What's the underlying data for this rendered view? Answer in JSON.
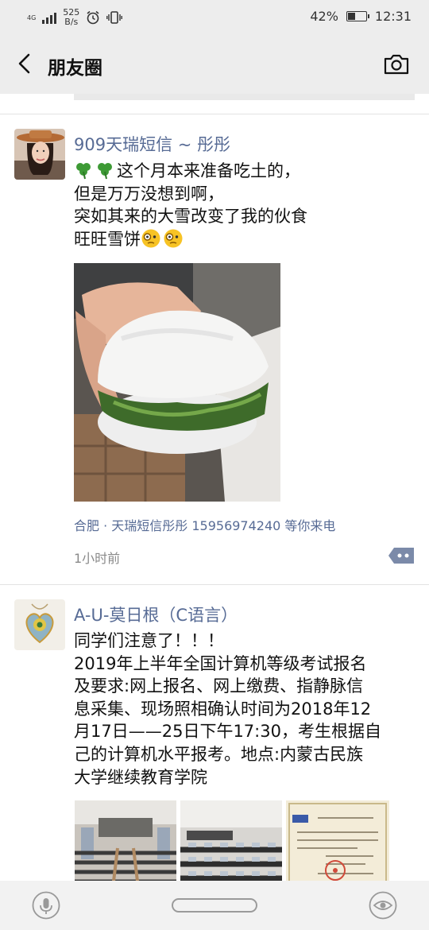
{
  "status_bar": {
    "network": "4G",
    "speed_value": "525",
    "speed_unit": "B/s",
    "battery_level": 0.42,
    "battery_percent": "42%",
    "time": "12:31"
  },
  "nav": {
    "title": "朋友圈"
  },
  "posts": [
    {
      "author": "909天瑞短信 ~ 彤彤",
      "text_line1": "这个月本来准备吃土的，",
      "text_line2": "但是万万没想到啊，",
      "text_line3": "突如其来的大雪改变了我的伙食",
      "text_line4": "旺旺雪饼",
      "location": "合肥 · 天瑞短信彤彤 15956974240 等你来电",
      "time": "1小时前"
    },
    {
      "author": "A-U-莫日根（C语言）",
      "text_line1": "同学们注意了！！！",
      "text_line2": "2019年上半年全国计算机等级考试报名",
      "text_line3": "及要求:网上报名、网上缴费、指静脉信",
      "text_line4": "息采集、现场照相确认时间为2018年12",
      "text_line5": "月17日——25日下午17:30，考生根据自",
      "text_line6": "己的计算机水平报考。地点:内蒙古民族",
      "text_line7": "大学继续教育学院",
      "images": [
        "classroom-photo",
        "computer-lab-photo",
        "certificate-photo"
      ]
    }
  ],
  "colors": {
    "link": "#576b95",
    "bar_bg": "#ededed"
  }
}
